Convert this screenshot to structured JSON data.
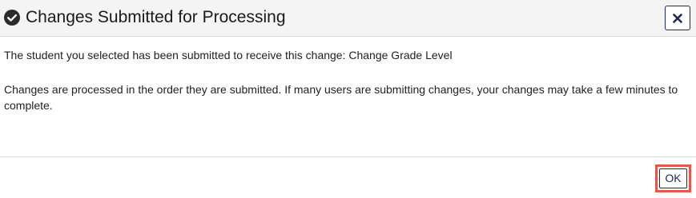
{
  "dialog": {
    "title": "Changes Submitted for Processing",
    "title_icon": "check-circle-icon",
    "close_icon": "close-icon",
    "message_line1": "The student you selected has been submitted to receive this change: Change Grade Level",
    "message_line2": "Changes are processed in the order they are submitted. If many users are submitting changes, your changes may take a few minutes to complete.",
    "ok_label": "OK"
  },
  "colors": {
    "header_bg": "#f4f4f4",
    "button_border": "#1f2a5c",
    "highlight": "#e4574c"
  }
}
